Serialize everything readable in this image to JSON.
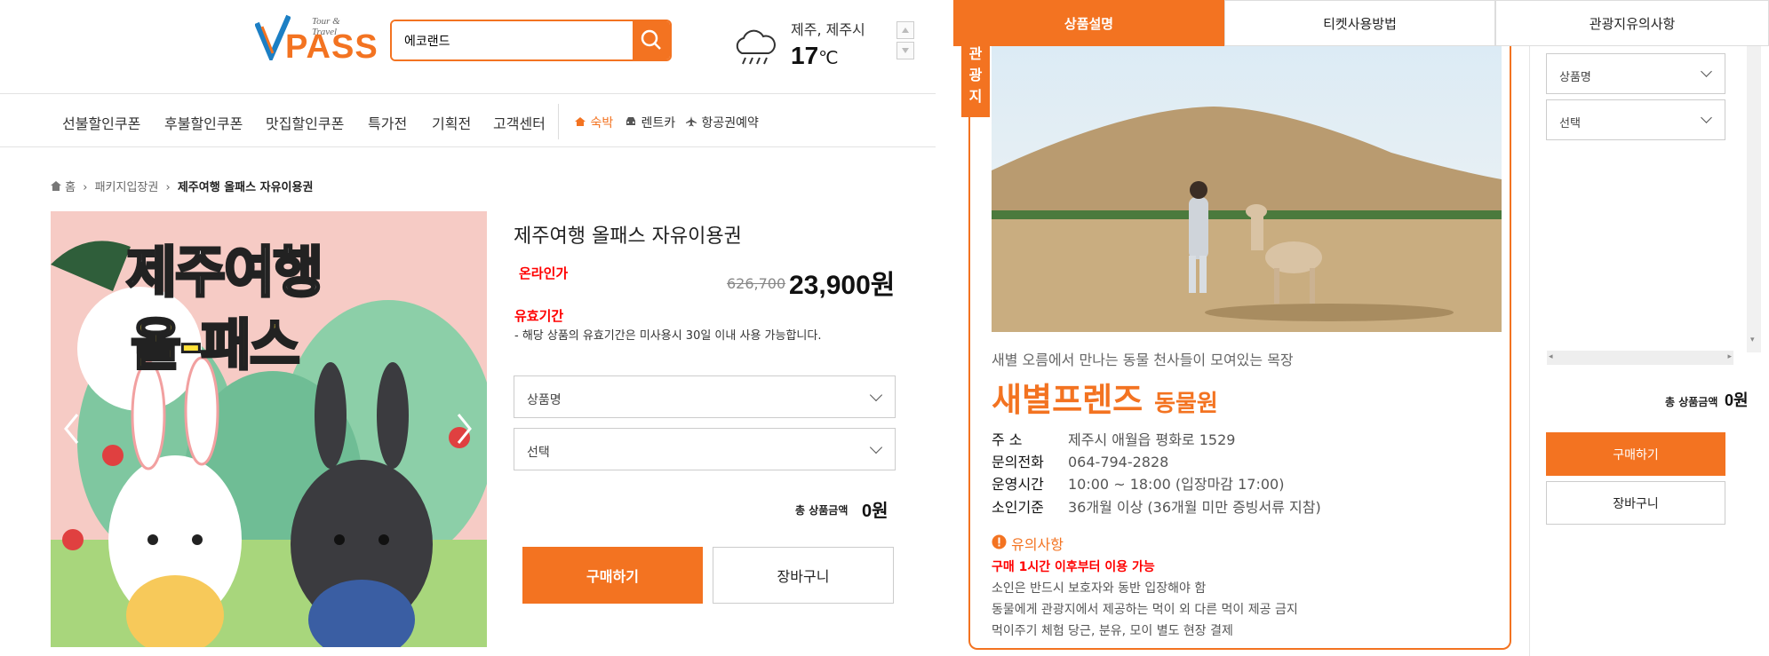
{
  "header": {
    "logo_tagline": "Tour & Travel",
    "logo_text": "PASS",
    "search_value": "에코랜드",
    "weather_location": "제주, 제주시",
    "weather_temp": "17",
    "weather_unit": "℃"
  },
  "nav": {
    "items": [
      "선불할인쿠폰",
      "후불할인쿠폰",
      "맛집할인쿠폰",
      "특가전",
      "기획전",
      "고객센터"
    ],
    "sub": [
      "숙박",
      "렌트카",
      "항공권예약"
    ]
  },
  "breadcrumb": [
    "홈",
    "패키지입장권",
    "제주여행 올패스 자유이용권"
  ],
  "banner": {
    "line1": "제주여행",
    "line2": "올-패스"
  },
  "product": {
    "title": "제주여행 올패스 자유이용권",
    "online_label": "온라인가",
    "original_price": "626,700",
    "price": "23,900원",
    "valid_label": "유효기간",
    "valid_desc": "- 해당 상품의 유효기간은 미사용시 30일 이내 사용 가능합니다.",
    "select_product": "상품명",
    "select_option": "선택",
    "total_label": "총 상품금액",
    "total_value": "0원",
    "buy_label": "구매하기",
    "cart_label": "장바구니"
  },
  "detail": {
    "tabs": [
      "상품설명",
      "티켓사용방법",
      "관광지유의사항"
    ],
    "ribbon": [
      "관",
      "광",
      "지"
    ],
    "tagline": "새별 오름에서 만나는 동물 천사들이 모여있는 목장",
    "name_main": "새별프렌즈",
    "name_sub": "동물원",
    "info": [
      {
        "k": "주    소",
        "v": "제주시 애월읍 평화로 1529"
      },
      {
        "k": "문의전화",
        "v": "064-794-2828"
      },
      {
        "k": "운영시간",
        "v": "10:00 ~ 18:00 (입장마감 17:00)"
      },
      {
        "k": "소인기준",
        "v": "36개월 이상 (36개월 미만 증빙서류 지참)"
      }
    ],
    "notice_title": "유의사항",
    "notice_red": "구매 1시간 이후부터 이용 가능",
    "notice_lines": [
      "소인은 반드시 보호자와 동반 입장해야 함",
      "동물에게 관광지에서 제공하는 먹이 외 다른 먹이 제공 금지",
      "먹이주기 체험 당근, 분유, 모이 별도 현장 결제"
    ]
  },
  "sidebar": {
    "select_product": "상품명",
    "select_option": "선택",
    "total_label": "총 상품금액",
    "total_value": "0원",
    "buy_label": "구매하기",
    "cart_label": "장바구니"
  },
  "colors": {
    "accent": "#f37321",
    "red": "#ff0000"
  }
}
